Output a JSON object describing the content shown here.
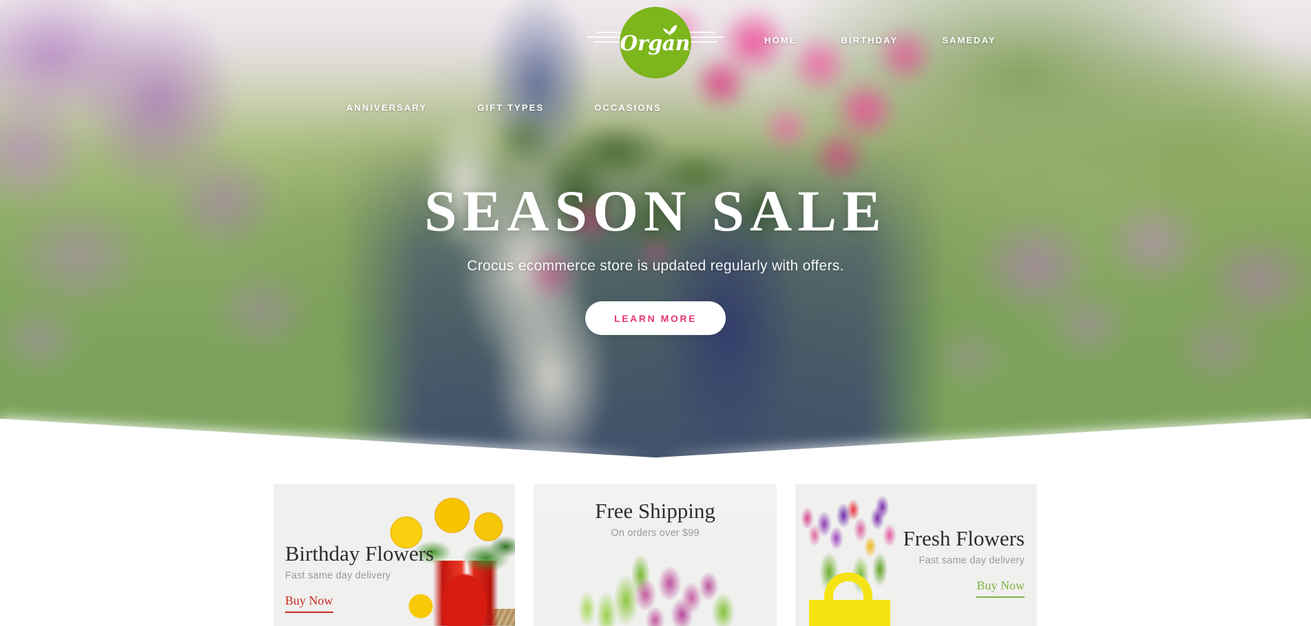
{
  "brand": {
    "logo_text": "Organ",
    "logo_bg_color": "#7db51c",
    "leaf_icon": "leaf-icon"
  },
  "nav": {
    "primary": [
      {
        "label": "HOME"
      },
      {
        "label": "BIRTHDAY"
      },
      {
        "label": "SAMEDAY"
      }
    ],
    "secondary": [
      {
        "label": "ANNIVERSARY"
      },
      {
        "label": "GIFT TYPES"
      },
      {
        "label": "OCCASIONS"
      }
    ]
  },
  "hero": {
    "title": "SEASON SALE",
    "subtitle": "Crocus ecommerce store is updated regularly with offers.",
    "cta_label": "LEARN MORE",
    "cta_text_color": "#e8376c",
    "cta_bg_color": "#ffffff"
  },
  "promos": [
    {
      "title": "Birthday Flowers",
      "subtitle": "Fast same day delivery",
      "cta_label": "Buy Now",
      "cta_color": "#cc2a22",
      "art": "sunflowers-in-red-pitcher"
    },
    {
      "title": "Free Shipping",
      "subtitle": "On orders over $99",
      "cta_label": "",
      "cta_color": "",
      "art": "pink-tulips"
    },
    {
      "title": "Fresh Flowers",
      "subtitle": "Fast same day delivery",
      "cta_label": "Buy Now",
      "cta_color": "#80b341",
      "art": "tulips-in-yellow-bag"
    }
  ]
}
